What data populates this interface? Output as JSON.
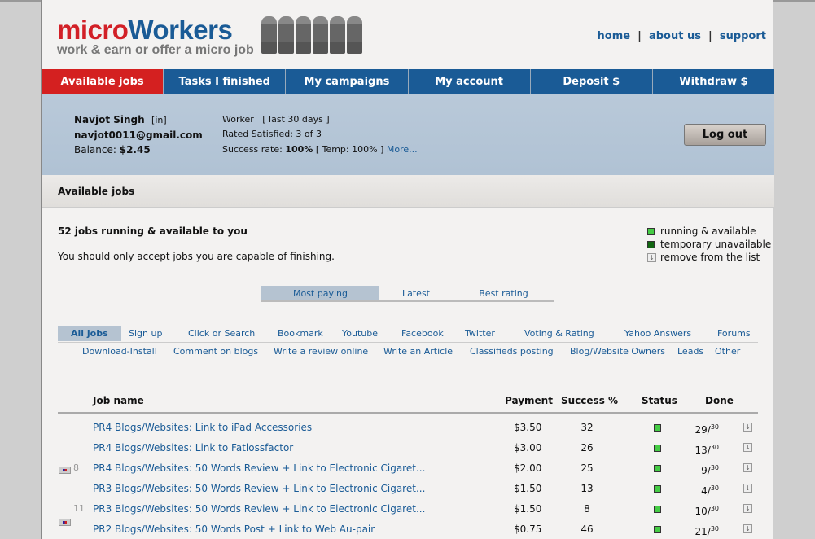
{
  "header": {
    "logo_micro": "micro",
    "logo_workers": "Workers",
    "tagline": "work & earn or offer a micro job",
    "links": [
      "home",
      "about us",
      "support"
    ]
  },
  "nav": [
    "Available jobs",
    "Tasks I finished",
    "My campaigns",
    "My account",
    "Deposit $",
    "Withdraw $"
  ],
  "user": {
    "name": "Navjot Singh",
    "tag": "[in]",
    "email": "navjot0011@gmail.com",
    "balance_label": "Balance:",
    "balance": "$2.45",
    "role": "Worker",
    "period": "[ last 30 days ]",
    "rated": "Rated Satisfied: 3 of 3",
    "success_label": "Success rate:",
    "success": "100%",
    "temp": "[ Temp: 100% ]",
    "more": "More...",
    "logout": "Log out"
  },
  "section_title": "Available jobs",
  "summary": {
    "count_text": "52 jobs running & available to you",
    "note": "You should only accept jobs you are capable of finishing."
  },
  "legend": [
    {
      "label": "running & available",
      "color": "#44cc44"
    },
    {
      "label": "temporary unavailable",
      "color": "#116611"
    },
    {
      "label": "remove from the list",
      "icon": "remove-icon"
    }
  ],
  "sort_tabs": [
    "Most paying",
    "Latest",
    "Best rating"
  ],
  "categories_row1": [
    "All jobs",
    "Sign up",
    "Click or Search",
    "Bookmark",
    "Youtube",
    "Facebook",
    "Twitter",
    "Voting & Rating",
    "Yahoo Answers",
    "Forums"
  ],
  "categories_row2": [
    "Download-Install",
    "Comment on blogs",
    "Write a review online",
    "Write an Article",
    "Classifieds posting",
    "Blog/Website Owners",
    "Leads",
    "Other"
  ],
  "table": {
    "headers": [
      "Job name",
      "Payment",
      "Success %",
      "Status",
      "Done"
    ],
    "rows": [
      {
        "flag": "",
        "count": "",
        "name": "PR4 Blogs/Websites: Link to iPad Accessories",
        "payment": "$3.50",
        "success": "32",
        "done": "29",
        "total": "30"
      },
      {
        "flag": "",
        "count": "",
        "name": "PR4 Blogs/Websites: Link to Fatlossfactor",
        "payment": "$3.00",
        "success": "26",
        "done": "13",
        "total": "30"
      },
      {
        "flag": "flag-icon",
        "count": "8",
        "name": "PR4 Blogs/Websites: 50 Words Review + Link to Electronic Cigaret...",
        "payment": "$2.00",
        "success": "25",
        "done": "9",
        "total": "30"
      },
      {
        "flag": "",
        "count": "",
        "name": "PR3 Blogs/Websites: 50 Words Review + Link to Electronic Cigaret...",
        "payment": "$1.50",
        "success": "13",
        "done": "4",
        "total": "30"
      },
      {
        "flag": "flag-icon",
        "count": "11",
        "name": "PR3 Blogs/Websites: 50 Words Review + Link to Electronic Cigaret...",
        "payment": "$1.50",
        "success": "8",
        "done": "10",
        "total": "30"
      },
      {
        "flag": "",
        "count": "",
        "name": "PR2 Blogs/Websites: 50 Words Post + Link to Web Au-pair",
        "payment": "$0.75",
        "success": "46",
        "done": "21",
        "total": "30"
      }
    ]
  }
}
